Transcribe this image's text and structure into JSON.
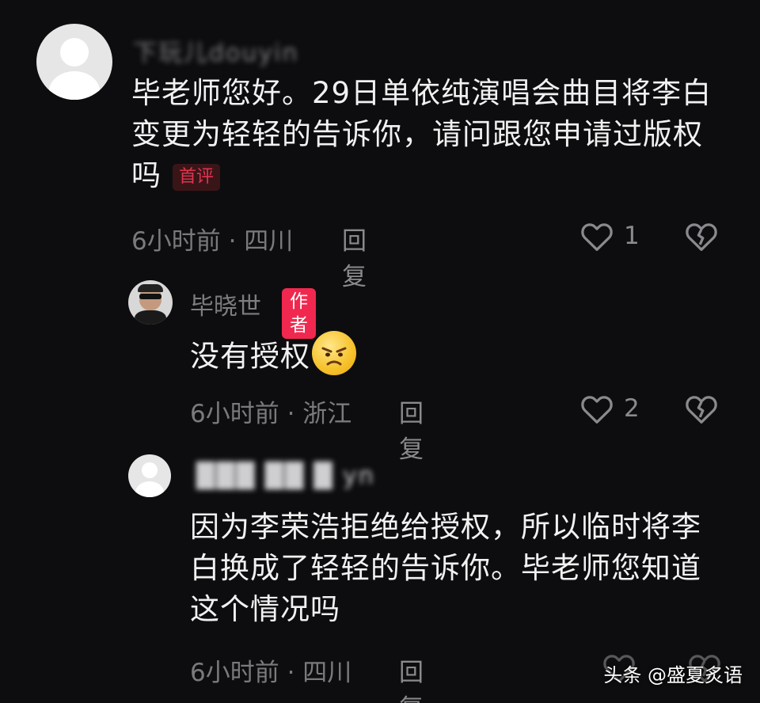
{
  "comments": [
    {
      "username": "下玩儿douyin",
      "text": "毕老师您好。29日单依纯演唱会曲目将李白变更为轻轻的告诉你，请问跟您申请过版权吗",
      "badge": "首评",
      "time": "6小时前 · 四川",
      "reply_label": "回复",
      "likes": "1"
    },
    {
      "username": "毕晓世",
      "badge": "作者",
      "text": "没有授权",
      "emoji": "angry-face-emoji",
      "time": "6小时前 · 浙江",
      "reply_label": "回复",
      "likes": "2"
    },
    {
      "username": "███ ██ █ yn",
      "text": "因为李荣浩拒绝给授权，所以临时将李白换成了轻轻的告诉你。毕老师您知道这个情况吗",
      "time": "6小时前 · 四川",
      "reply_label": "回复"
    }
  ],
  "watermark": "头条 @盛夏炙语",
  "colors": {
    "background": "#0d0d0f",
    "author_badge": "#f0284f",
    "first_badge": "#e0344f",
    "muted_text": "#7a7a7e"
  },
  "icons": [
    "heart-icon",
    "broken-heart-icon",
    "default-avatar-icon"
  ]
}
